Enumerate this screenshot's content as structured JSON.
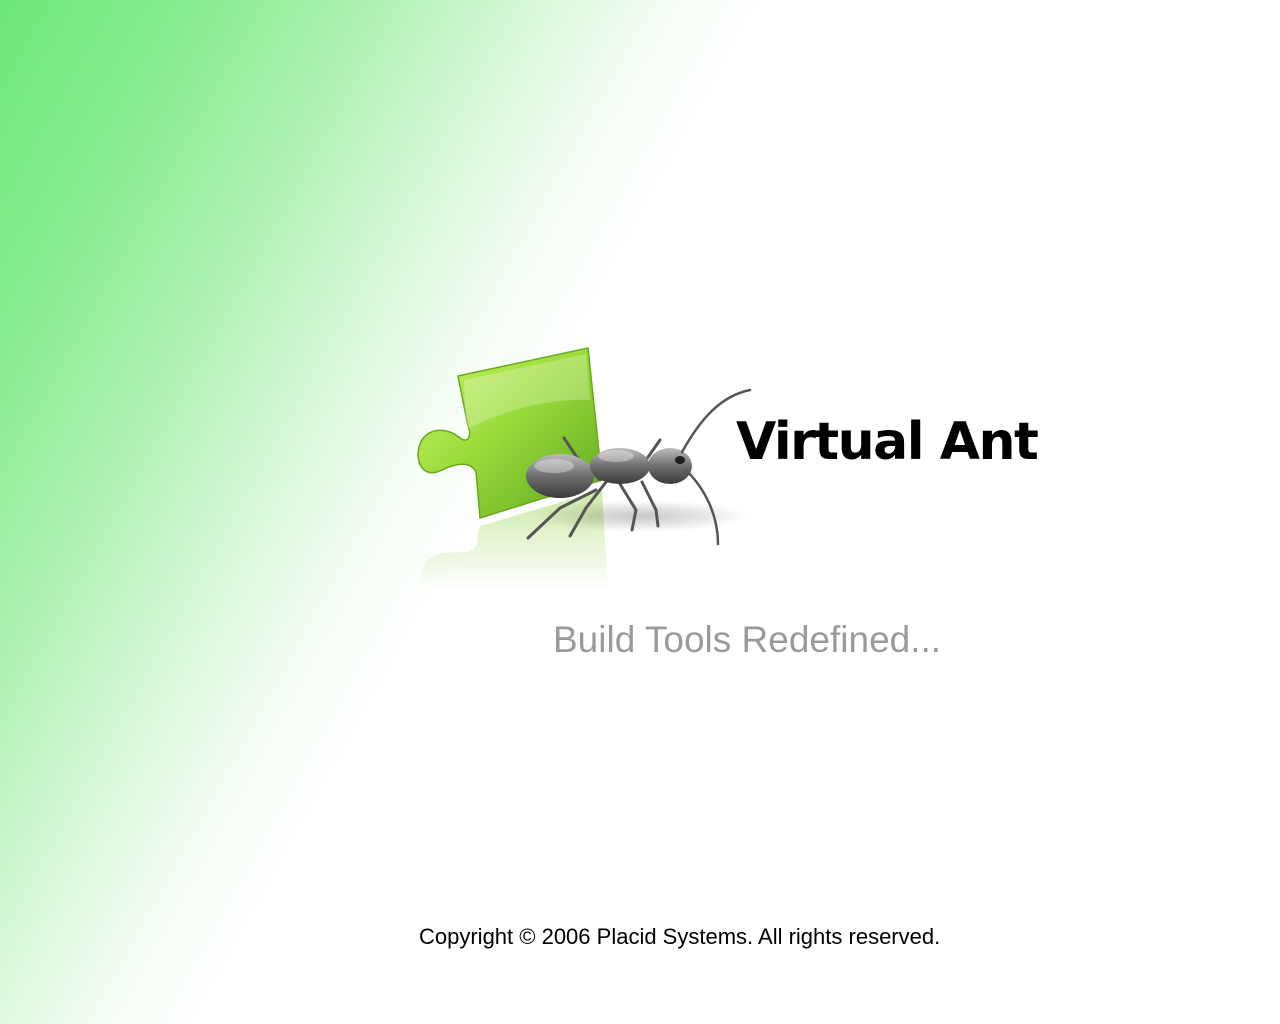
{
  "splash": {
    "product_name": "Virtual Ant",
    "tagline": "Build Tools Redefined...",
    "copyright": "Copyright © 2006 Placid Systems. All rights reserved.",
    "icons": [
      "puzzle-piece-icon",
      "ant-icon"
    ],
    "colors": {
      "background": "#ffffff",
      "accent_green": "#6fe87b",
      "puzzle_green": "#8fd13a",
      "tagline_gray": "#9a9a9a",
      "text": "#000000"
    }
  }
}
